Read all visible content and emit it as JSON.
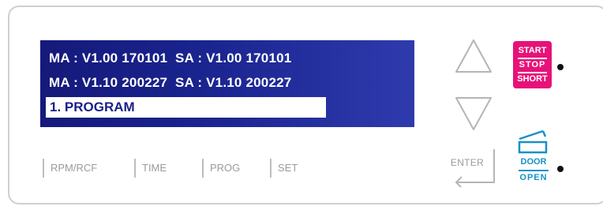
{
  "display": {
    "line1": "MA : V1.00 170101  SA : V1.00 170101",
    "line2": "MA : V1.10 200227  SA : V1.10 200227",
    "selected": "1. PROGRAM"
  },
  "modes": [
    "RPM/RCF",
    "TIME",
    "PROG",
    "SET"
  ],
  "buttons": {
    "up_icon": "triangle-up-icon",
    "down_icon": "triangle-down-icon",
    "enter_label": "ENTER",
    "start_label": "START",
    "stop_label": "STOP",
    "short_label": "SHORT",
    "door_top_label": "DOOR",
    "door_bottom_label": "OPEN"
  },
  "colors": {
    "lcd_background": "#1a2590",
    "start_stop_button": "#e6127a",
    "door_button": "#1591c8",
    "mode_label": "#9a9a9a"
  }
}
